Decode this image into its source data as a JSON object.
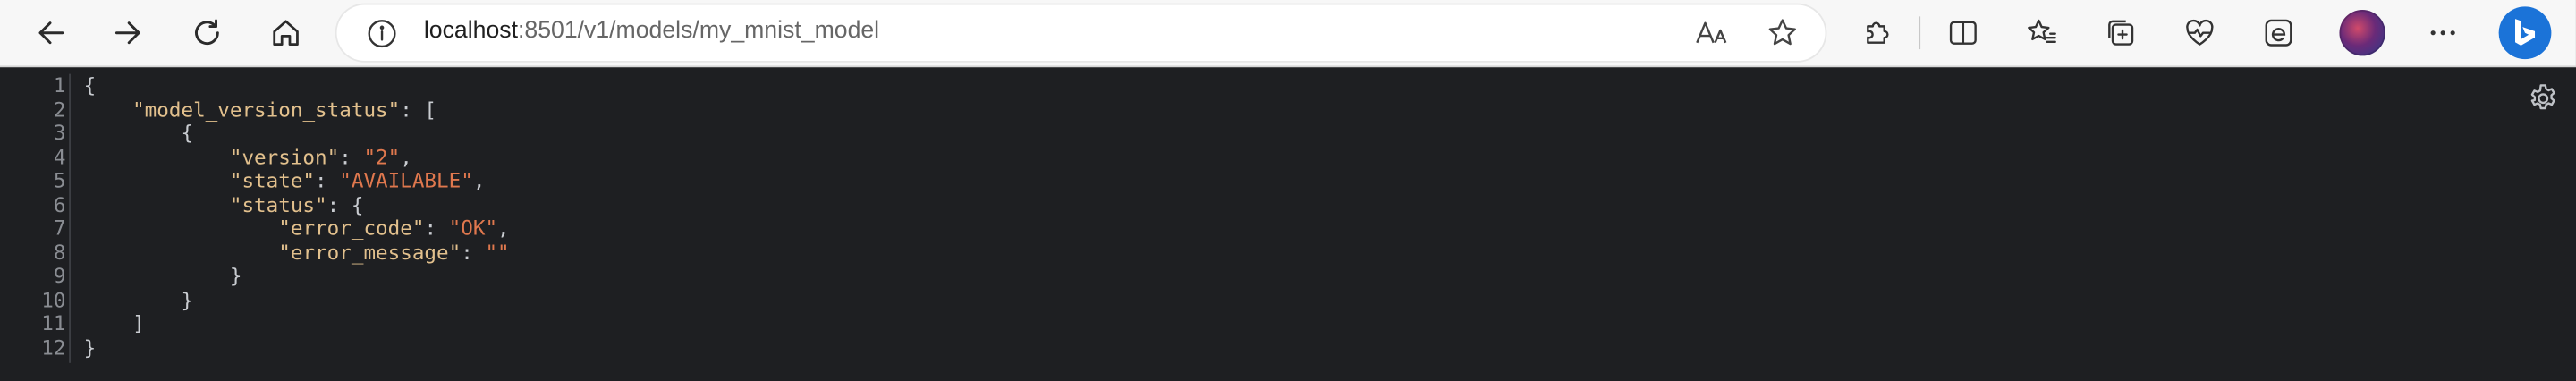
{
  "browser": {
    "address": {
      "host": "localhost",
      "rest": ":8501/v1/models/my_mnist_model"
    }
  },
  "json_lines": [
    [
      {
        "t": "p",
        "v": "{"
      }
    ],
    [
      {
        "t": "p",
        "v": "    "
      },
      {
        "t": "k",
        "v": "\"model_version_status\""
      },
      {
        "t": "p",
        "v": ": ["
      }
    ],
    [
      {
        "t": "p",
        "v": "        {"
      }
    ],
    [
      {
        "t": "p",
        "v": "            "
      },
      {
        "t": "k",
        "v": "\"version\""
      },
      {
        "t": "p",
        "v": ": "
      },
      {
        "t": "s",
        "v": "\"2\""
      },
      {
        "t": "p",
        "v": ","
      }
    ],
    [
      {
        "t": "p",
        "v": "            "
      },
      {
        "t": "k",
        "v": "\"state\""
      },
      {
        "t": "p",
        "v": ": "
      },
      {
        "t": "s",
        "v": "\"AVAILABLE\""
      },
      {
        "t": "p",
        "v": ","
      }
    ],
    [
      {
        "t": "p",
        "v": "            "
      },
      {
        "t": "k",
        "v": "\"status\""
      },
      {
        "t": "p",
        "v": ": {"
      }
    ],
    [
      {
        "t": "p",
        "v": "                "
      },
      {
        "t": "k",
        "v": "\"error_code\""
      },
      {
        "t": "p",
        "v": ": "
      },
      {
        "t": "s",
        "v": "\"OK\""
      },
      {
        "t": "p",
        "v": ","
      }
    ],
    [
      {
        "t": "p",
        "v": "                "
      },
      {
        "t": "k",
        "v": "\"error_message\""
      },
      {
        "t": "p",
        "v": ": "
      },
      {
        "t": "s",
        "v": "\"\""
      }
    ],
    [
      {
        "t": "p",
        "v": "            }"
      }
    ],
    [
      {
        "t": "p",
        "v": "        }"
      }
    ],
    [
      {
        "t": "p",
        "v": "    ]"
      }
    ],
    [
      {
        "t": "p",
        "v": "}"
      }
    ]
  ],
  "colors": {
    "json_key": "#e2c08d",
    "json_string": "#e0784e",
    "json_punct": "#c9ccd1",
    "viewer_bg": "#1e1f22",
    "line_number": "#8a8d93"
  }
}
